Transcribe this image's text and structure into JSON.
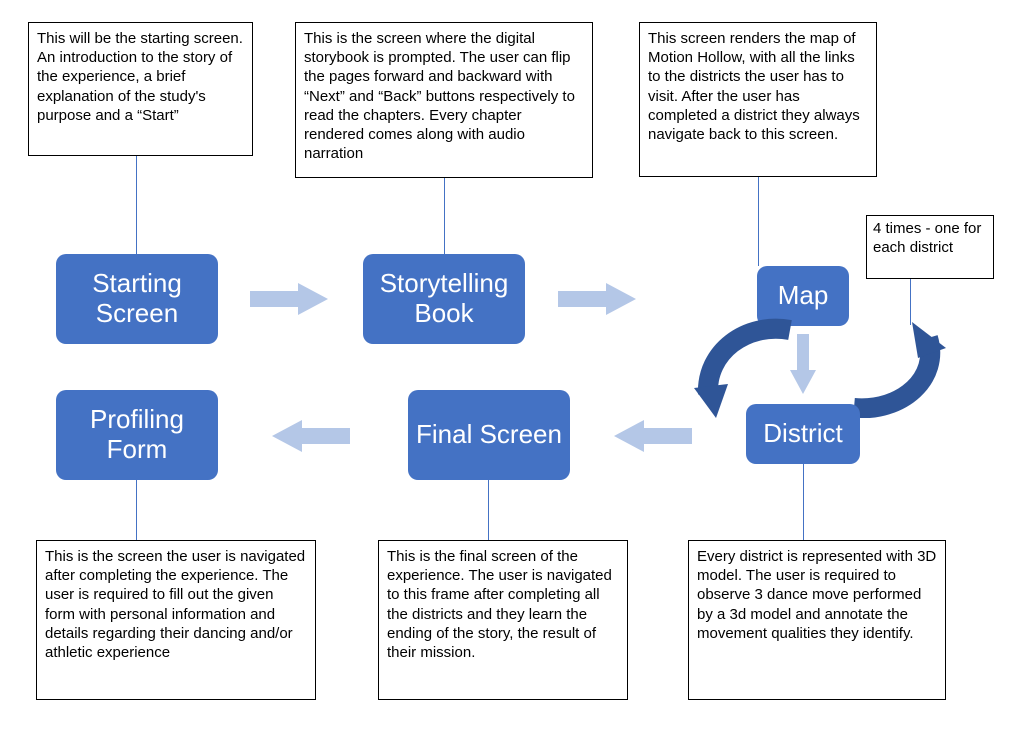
{
  "diagram": {
    "type": "flow-diagram",
    "topic": "Motion Hollow experience flow",
    "colors": {
      "node_fill": "#4472c4",
      "node_text": "#ffffff",
      "light_arrow": "#b4c7e7",
      "dark_arrow": "#2f5597"
    }
  },
  "nodes": {
    "starting_screen": {
      "label": "Starting Screen"
    },
    "storytelling_book": {
      "label": "Storytelling Book"
    },
    "map": {
      "label": "Map"
    },
    "district": {
      "label": "District"
    },
    "final_screen": {
      "label": "Final Screen"
    },
    "profiling_form": {
      "label": "Profiling Form"
    }
  },
  "loop_note": {
    "text": "4 times - one for each district"
  },
  "descriptions": {
    "starting_screen": "This will be the starting screen. An introduction to the story of the experience, a brief explanation of the study's purpose and a “Start”",
    "storytelling_book": "This is the screen where the digital storybook is prompted. The user can flip the pages forward and backward with “Next” and “Back” buttons respectively to read the chapters. Every chapter rendered comes along with audio narration",
    "map": "This screen renders the map of Motion Hollow, with all the links to the districts the user has to visit.  After the user has completed a district they always navigate back to this screen.",
    "district": "Every district is represented with 3D model. The user is required to observe 3 dance move performed by a 3d model and annotate the movement qualities they identify.",
    "final_screen": "This is the final screen of the experience. The user is navigated to this frame after completing all the districts and they learn the ending of the story, the result of their mission.",
    "profiling_form": "This is the screen the user is navigated after completing the experience. The user is required to fill out the given form with personal information and details regarding their dancing and/or athletic experience"
  },
  "edges": [
    {
      "from": "starting_screen",
      "to": "storytelling_book",
      "style": "light-right"
    },
    {
      "from": "storytelling_book",
      "to": "map",
      "style": "light-right"
    },
    {
      "from": "map",
      "to": "district",
      "style": "light-down"
    },
    {
      "from": "district",
      "to": "map",
      "style": "dark-loop",
      "note_ref": "loop_note"
    },
    {
      "from": "district",
      "to": "final_screen",
      "style": "light-left"
    },
    {
      "from": "final_screen",
      "to": "profiling_form",
      "style": "light-left"
    }
  ]
}
